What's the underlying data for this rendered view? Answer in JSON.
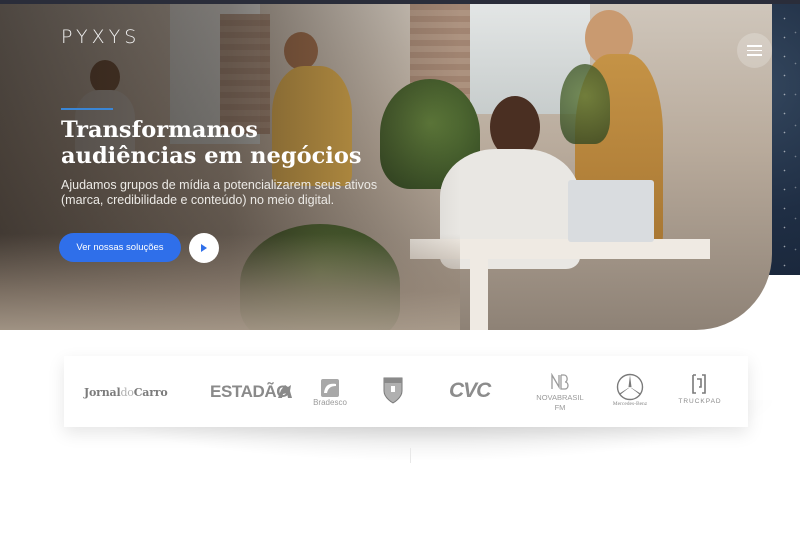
{
  "header": {
    "logo_text": "PYXYS",
    "menu_icon": "hamburger-icon"
  },
  "hero": {
    "headline_line1": "Transformamos",
    "headline_line2": "audiências em negócios",
    "subtitle_line1": "Ajudamos grupos de mídia a potencializarem seus ativos",
    "subtitle_line2": "(marca, credibilidade e conteúdo) no meio digital.",
    "cta_label": "Ver nossas soluções",
    "play_icon": "play-icon"
  },
  "clients": {
    "jornal_part1": "Jornal",
    "jornal_part2": "do",
    "jornal_part3": "Carro",
    "estadao": "ESTADÃO",
    "bradesco": "Bradesco",
    "cvc": "CVC",
    "novabrasil": "NOVABRASIL FM",
    "mercedes": "Mercedes-Benz",
    "truckpad": "TRUCKPAD"
  },
  "colors": {
    "accent_blue": "#2f6fea",
    "accent_line": "#3a86d6",
    "dark_panel": "#1f2e44",
    "logo_gray": "#8c8c8c"
  }
}
